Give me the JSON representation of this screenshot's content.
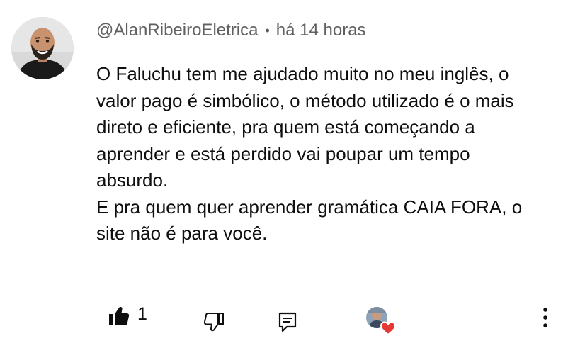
{
  "comment": {
    "author": "@AlanRibeiroEletrica",
    "separator": "•",
    "time": "há 14 horas",
    "paragraphs": [
      "O Faluchu tem me ajudado muito no meu inglês, o valor pago é simbólico, o método utilizado é o mais direto e eficiente, pra quem está começando a aprender e está perdido vai poupar um tempo absurdo.",
      "E pra quem quer aprender gramática CAIA FORA, o site não é para você."
    ],
    "like_count": "1"
  },
  "icons": {
    "avatar": "user-avatar",
    "like": "thumbs-up-icon",
    "dislike": "thumbs-down-icon",
    "reply": "reply-icon",
    "creator_heart": "creator-heart-icon",
    "menu": "more-vertical-icon"
  },
  "colors": {
    "text": "#0f0f0f",
    "secondary_text": "#606060",
    "heart": "#e53935"
  }
}
